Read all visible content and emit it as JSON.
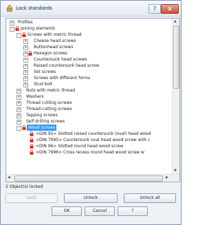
{
  "window": {
    "title": "Lock standards",
    "help_label": "?",
    "close_label": "x"
  },
  "tree": {
    "items": [
      {
        "label": "Profiles",
        "expander": "+"
      },
      {
        "label": "Joining elements",
        "expander": "-"
      },
      {
        "label": "Screws with metric thread",
        "expander": "-"
      },
      {
        "label": "Cheese head screws",
        "expander": "+"
      },
      {
        "label": "Buttonhead screws",
        "expander": "+"
      },
      {
        "label": "Hexagon screws",
        "expander": "+"
      },
      {
        "label": "Countersunk head screws",
        "expander": "+"
      },
      {
        "label": "Raised countersunk head screw",
        "expander": "+"
      },
      {
        "label": "Set screws",
        "expander": "+"
      },
      {
        "label": "Screws with different forms",
        "expander": "+"
      },
      {
        "label": "Stud bolt",
        "expander": "+"
      },
      {
        "label": "Nuts with metric thread",
        "expander": "+"
      },
      {
        "label": "Washers",
        "expander": "+"
      },
      {
        "label": "Thread cutting screws",
        "expander": "+"
      },
      {
        "label": "Thread-cutting screws",
        "expander": "+"
      },
      {
        "label": "Tapping screws",
        "expander": "+"
      },
      {
        "label": "Self drilling screws",
        "expander": "+"
      },
      {
        "label": "Wood screws",
        "expander": "-"
      },
      {
        "label": "<DIN 95>  Slotted raised countersunk (oval) head wood",
        "expander": ""
      },
      {
        "label": "<DIN 7995>  Countersunk oval head wood screw with c",
        "expander": ""
      },
      {
        "label": "<DIN 96>  Slotted round head wood screw",
        "expander": ""
      },
      {
        "label": "<DIN 7996>  Cross recess round head wood screw w",
        "expander": ""
      }
    ]
  },
  "status": {
    "text": "2 Object(s) locked"
  },
  "buttons": {
    "lock": "Lock",
    "unlock": "Unlock",
    "unlock_all": "Unlock all",
    "ok": "OK",
    "cancel": "Cancel",
    "help": "?"
  },
  "colors": {
    "selection": "#3399ff",
    "lock_icon": "#e0221a"
  },
  "icons": {
    "title": "padlock-icon",
    "locked_item": "red-padlock-icon"
  }
}
